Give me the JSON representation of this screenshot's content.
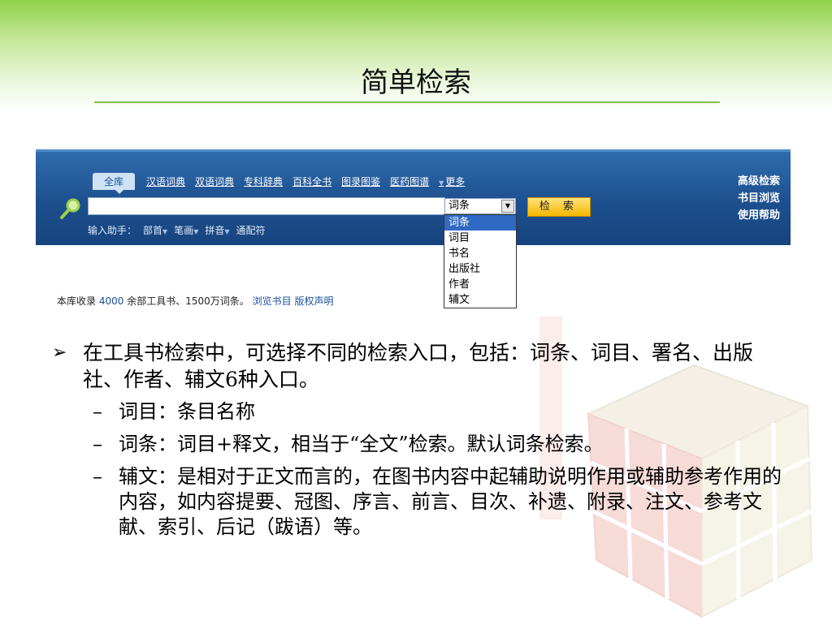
{
  "slide": {
    "title": "简单检索"
  },
  "search_panel": {
    "tabs": [
      "全库",
      "汉语词典",
      "双语词典",
      "专科辞典",
      "百科全书",
      "图录图鉴",
      "医药图谱",
      "更多"
    ],
    "right_links": [
      "高级检索",
      "书目浏览",
      "使用帮助"
    ],
    "search_input": {
      "value": "",
      "placeholder": ""
    },
    "field_select": {
      "value": "词条",
      "options": [
        "词条",
        "词目",
        "书名",
        "出版社",
        "作者",
        "辅文"
      ]
    },
    "search_button": "检 索",
    "assist_label": "输入助手：",
    "assist_items": [
      "部首",
      "笔画",
      "拼音",
      "通配符"
    ]
  },
  "library_info": {
    "prefix": "本库收录",
    "count": "4000",
    "suffix": "余部工具书、1500万词条。",
    "browse_link": "浏览书目",
    "copyright_link": "版权声明"
  },
  "bullets": {
    "main": "在工具书检索中，可选择不同的检索入口，包括：词条、词目、署名、出版社、作者、辅文6种入口。",
    "subs": [
      "词目：条目名称",
      "词条：词目+释文，相当于“全文”检索。默认词条检索。",
      "辅文：是相对于正文而言的，在图书内容中起辅助说明作用或辅助参考作用的内容，如内容提要、冠图、序言、前言、目次、补遗、附录、注文、参考文献、索引、后记（跋语）等。"
    ]
  },
  "colors": {
    "accent_green": "#7cc242",
    "panel_blue": "#1d4f8e",
    "button_yellow": "#f5b800"
  }
}
